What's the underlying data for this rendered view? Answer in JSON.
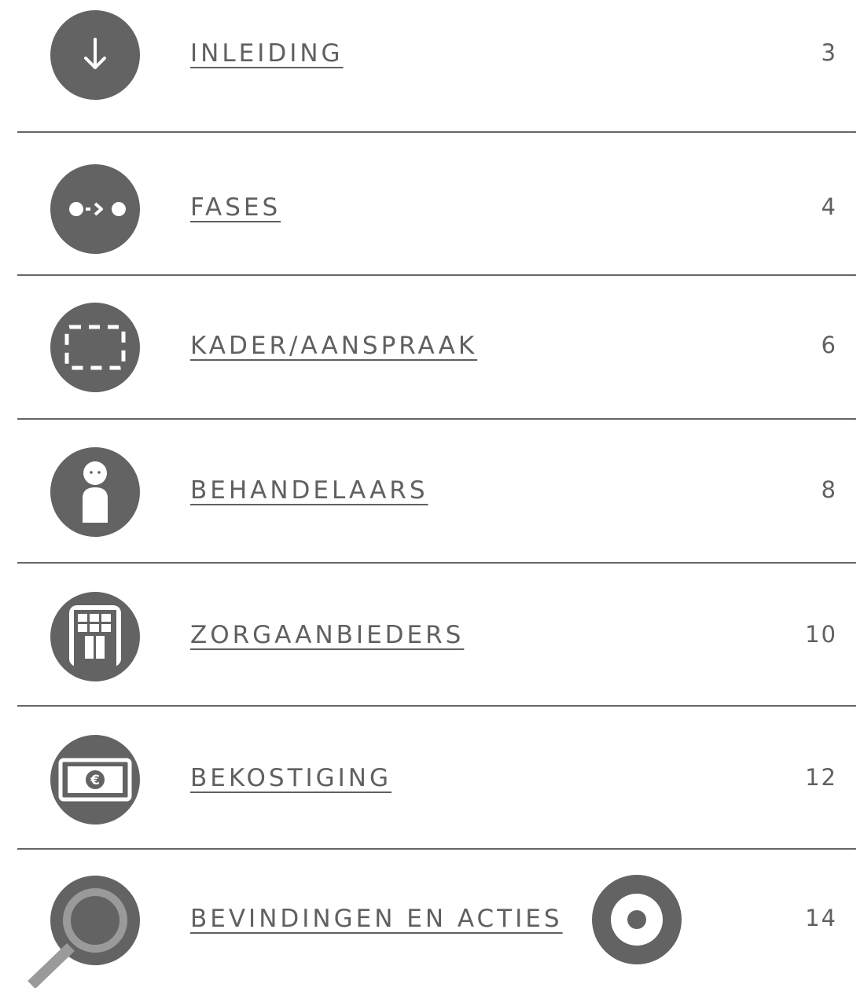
{
  "toc": {
    "items": [
      {
        "title": "INLEIDING",
        "page": "3",
        "icon": "arrow-down-icon"
      },
      {
        "title": "FASES",
        "page": "4",
        "icon": "phases-flow-icon"
      },
      {
        "title": "KADER/AANSPRAAK",
        "page": "6",
        "icon": "dashed-frame-icon"
      },
      {
        "title": "BEHANDELAARS",
        "page": "8",
        "icon": "person-icon"
      },
      {
        "title": "ZORGAANBIEDERS",
        "page": "10",
        "icon": "building-icon"
      },
      {
        "title": "BEKOSTIGING",
        "page": "12",
        "icon": "euro-banknote-icon"
      },
      {
        "title": "BEVINDINGEN EN ACTIES",
        "page": "14",
        "icon": "magnifier-icon",
        "extra_icon": "target-icon"
      }
    ]
  },
  "colors": {
    "icon_fill": "#636363",
    "text": "#606060",
    "divider": "#666666",
    "magnifier_ring": "#9a9a9a"
  }
}
